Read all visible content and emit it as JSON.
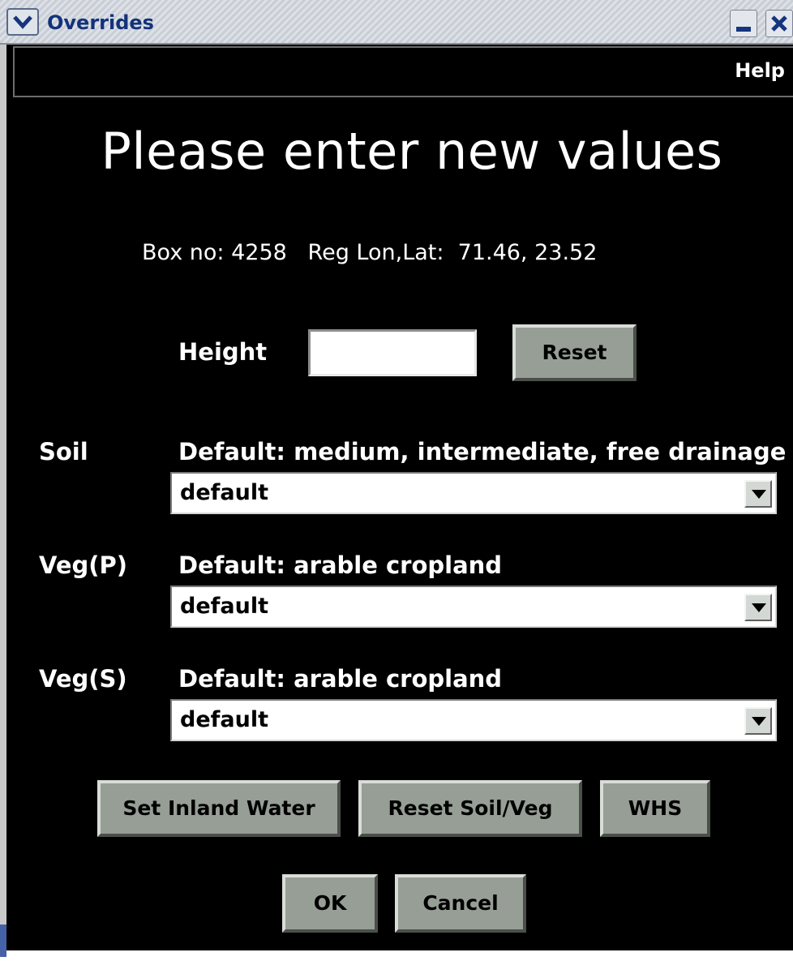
{
  "window": {
    "title": "Overrides",
    "menu_help": "Help"
  },
  "main": {
    "heading": "Please enter new values",
    "box_info": "Box no: 4258   Reg Lon,Lat:  71.46, 23.52"
  },
  "height": {
    "label": "Height",
    "value": "",
    "reset_label": "Reset"
  },
  "soil": {
    "label": "Soil",
    "default_text": "Default: medium, intermediate, free drainage",
    "selected": "default"
  },
  "veg_p": {
    "label": "Veg(P)",
    "default_text": "Default: arable cropland",
    "selected": "default"
  },
  "veg_s": {
    "label": "Veg(S)",
    "default_text": "Default: arable cropland",
    "selected": "default"
  },
  "actions": {
    "set_inland_water": "Set Inland Water",
    "reset_soil_veg": "Reset Soil/Veg",
    "whs": "WHS",
    "ok": "OK",
    "cancel": "Cancel"
  }
}
